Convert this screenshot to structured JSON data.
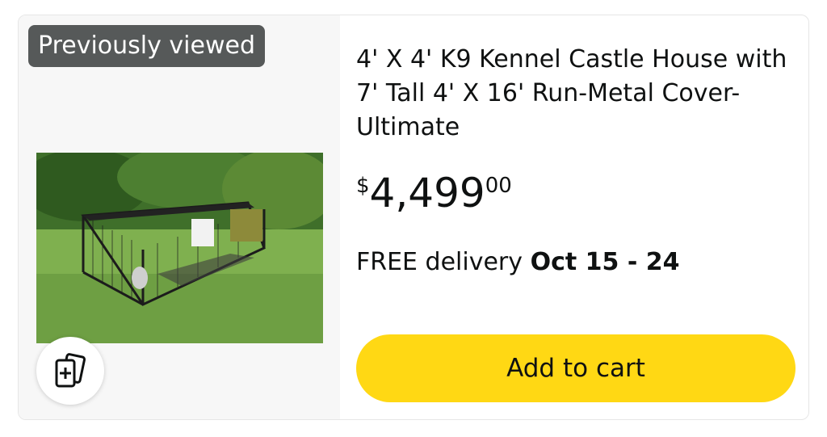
{
  "badge": {
    "label": "Previously viewed"
  },
  "product": {
    "title": "4' X 4' K9 Kennel Castle House with 7' Tall 4' X 16' Run-Metal Cover-Ultimate",
    "price": {
      "symbol": "$",
      "whole": "4,499",
      "fraction": "00"
    },
    "delivery": {
      "prefix": "FREE delivery",
      "dates": "Oct 15 - 24"
    },
    "image_alt": "dog kennel with metal cover on grass"
  },
  "actions": {
    "add_to_cart": "Add to cart",
    "compare_icon": "compare-cards-icon"
  },
  "colors": {
    "button": "#ffd814",
    "badge": "#565959",
    "panel": "#f7f7f7"
  }
}
